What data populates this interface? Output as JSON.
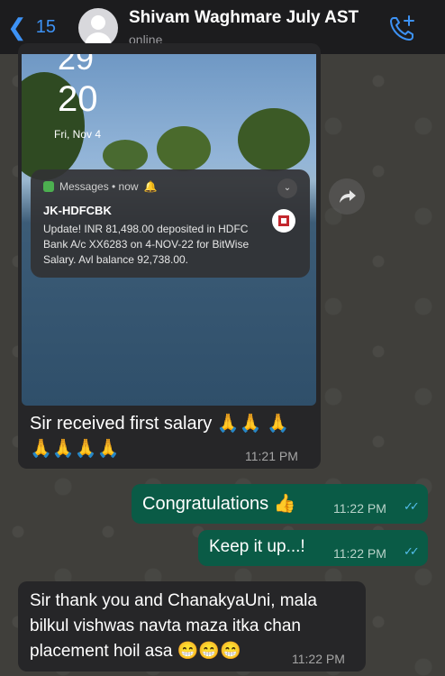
{
  "header": {
    "back_count": "15",
    "contact_name": "Shivam Waghmare July AST",
    "status": "online"
  },
  "messages": [
    {
      "direction": "incoming",
      "type": "image",
      "image": {
        "lock_time_top": "29",
        "lock_time": "20",
        "lock_date": "Fri, Nov 4",
        "notification": {
          "app": "Messages • now",
          "sender": "JK-HDFCBK",
          "body": "Update! INR 81,498.00 deposited in HDFC Bank A/c XX6283 on 4-NOV-22 for BitWise Salary. Avl balance 92,738.00."
        }
      },
      "text": "Sir received first salary 🙏🙏 🙏🙏🙏🙏🙏",
      "time": "11:21 PM"
    },
    {
      "direction": "outgoing",
      "text": "Congratulations 👍",
      "time": "11:22 PM",
      "read": true
    },
    {
      "direction": "outgoing",
      "text": "Keep it up...!",
      "time": "11:22 PM",
      "read": true
    },
    {
      "direction": "incoming",
      "text": "Sir thank you and ChanakyaUni, mala bilkul vishwas navta maza itka chan placement hoil asa 😁😁😁",
      "time": "11:22 PM"
    }
  ],
  "colors": {
    "accent": "#3d92f5",
    "outgoing_bubble": "#0a5b46",
    "incoming_bubble": "#262628",
    "read_tick": "#53bdeb"
  }
}
